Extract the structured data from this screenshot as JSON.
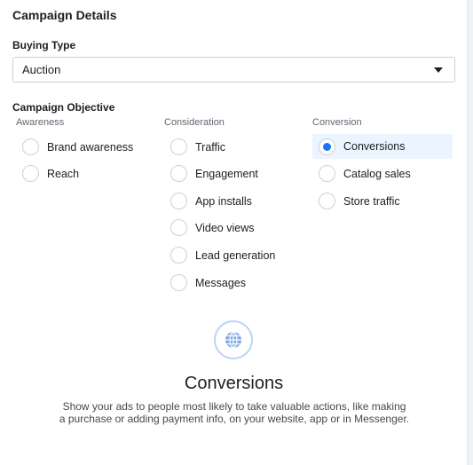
{
  "section_title": "Campaign Details",
  "buying_type": {
    "label": "Buying Type",
    "value": "Auction"
  },
  "objective": {
    "label": "Campaign Objective",
    "columns": [
      {
        "heading": "Awareness",
        "options": [
          "Brand awareness",
          "Reach"
        ]
      },
      {
        "heading": "Consideration",
        "options": [
          "Traffic",
          "Engagement",
          "App installs",
          "Video views",
          "Lead generation",
          "Messages"
        ]
      },
      {
        "heading": "Conversion",
        "options": [
          "Conversions",
          "Catalog sales",
          "Store traffic"
        ]
      }
    ],
    "selected": "Conversions"
  },
  "detail": {
    "icon": "globe-icon",
    "title": "Conversions",
    "description": "Show your ads to people most likely to take valuable actions, like making a purchase or adding payment info, on your website, app or in Messenger."
  },
  "colors": {
    "accent": "#1877f2",
    "selected_bg": "#ebf5ff"
  }
}
